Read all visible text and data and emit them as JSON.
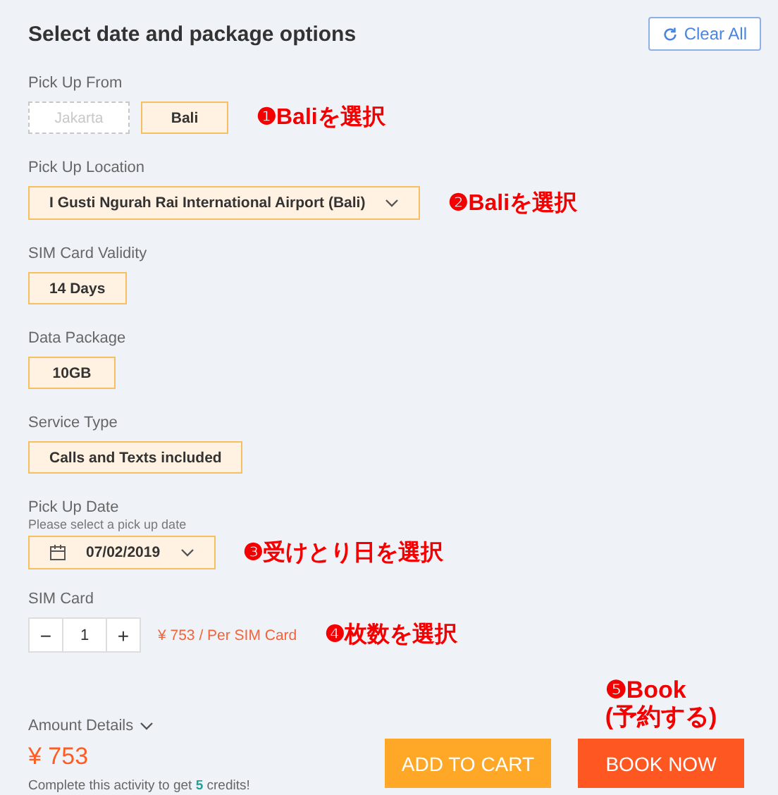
{
  "title": "Select date and package options",
  "clear_button": {
    "label": "Clear All"
  },
  "sections": [
    {
      "kind": "options",
      "label": "Pick Up From",
      "annotation": "❶Baliを選択",
      "options": [
        {
          "label": "Jakarta",
          "selected": false,
          "disabled": true
        },
        {
          "label": "Bali",
          "selected": true,
          "disabled": false
        }
      ]
    },
    {
      "kind": "select",
      "label": "Pick Up Location",
      "annotation": "❷Baliを選択",
      "value": "I Gusti Ngurah Rai International Airport (Bali)"
    },
    {
      "kind": "options",
      "label": "SIM Card Validity",
      "options": [
        {
          "label": "14 Days",
          "selected": true,
          "disabled": false
        }
      ]
    },
    {
      "kind": "options",
      "label": "Data Package",
      "options": [
        {
          "label": "10GB",
          "selected": true,
          "disabled": false
        }
      ]
    },
    {
      "kind": "options",
      "label": "Service Type",
      "options": [
        {
          "label": "Calls and Texts included",
          "selected": true,
          "disabled": false
        }
      ]
    },
    {
      "kind": "date",
      "label": "Pick Up Date",
      "hint": "Please select a pick up date",
      "annotation": "❸受けとり日を選択",
      "value": "07/02/2019"
    },
    {
      "kind": "quantity",
      "label": "SIM Card",
      "annotation": "❹枚数を選択",
      "minus": "−",
      "value": "1",
      "plus": "+",
      "unit_price": "¥ 753 / Per SIM Card"
    }
  ],
  "amount": {
    "label": "Amount Details",
    "total": "¥ 753",
    "credits": {
      "before": "Complete this activity to get",
      "count": "5",
      "after": "credits!"
    }
  },
  "book_annotation": [
    "❺Book",
    "(予約する)"
  ],
  "buttons": [
    {
      "kind": "cart",
      "label": "ADD TO CART"
    },
    {
      "kind": "book",
      "label": "BOOK NOW"
    }
  ]
}
